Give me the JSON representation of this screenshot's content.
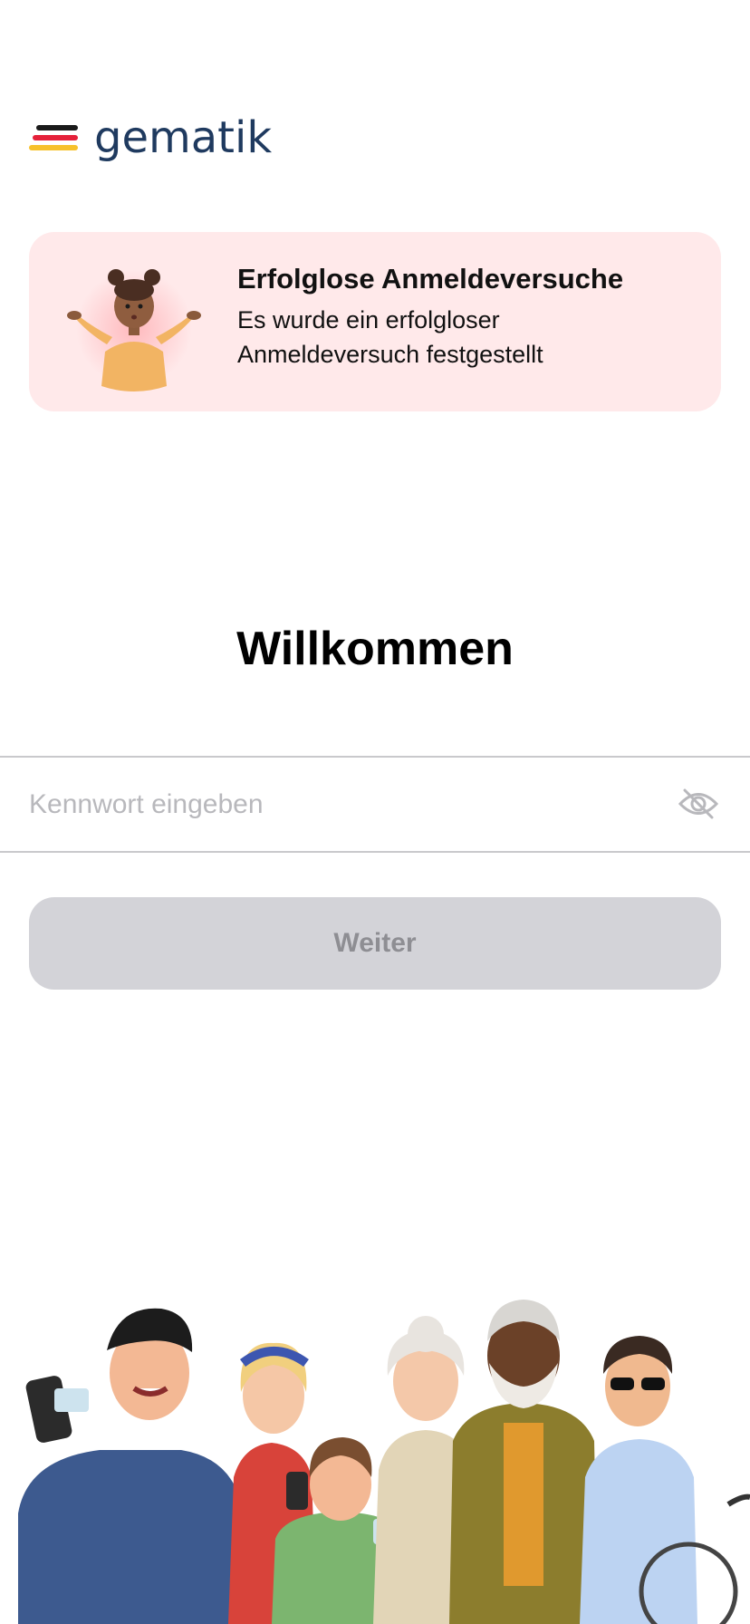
{
  "logo": {
    "text": "gematik",
    "flag_colors": [
      "#1a1a1a",
      "#e5213a",
      "#f7c12b"
    ]
  },
  "alert": {
    "title": "Erfolglose Anmeldeversuche",
    "line1": "Es wurde ein erfolgloser",
    "line2": "Anmeldeversuch festgestellt",
    "background": "#ffe9ea"
  },
  "welcome": {
    "title": "Willkommen"
  },
  "password": {
    "placeholder": "Kennwort eingeben",
    "value": "",
    "toggle_icon": "eye-slash-icon"
  },
  "continue_button": {
    "label": "Weiter",
    "enabled": false
  },
  "colors": {
    "brand_navy": "#1f3a5f",
    "button_disabled_bg": "#d3d3d8",
    "button_disabled_text": "#8e8e93"
  }
}
